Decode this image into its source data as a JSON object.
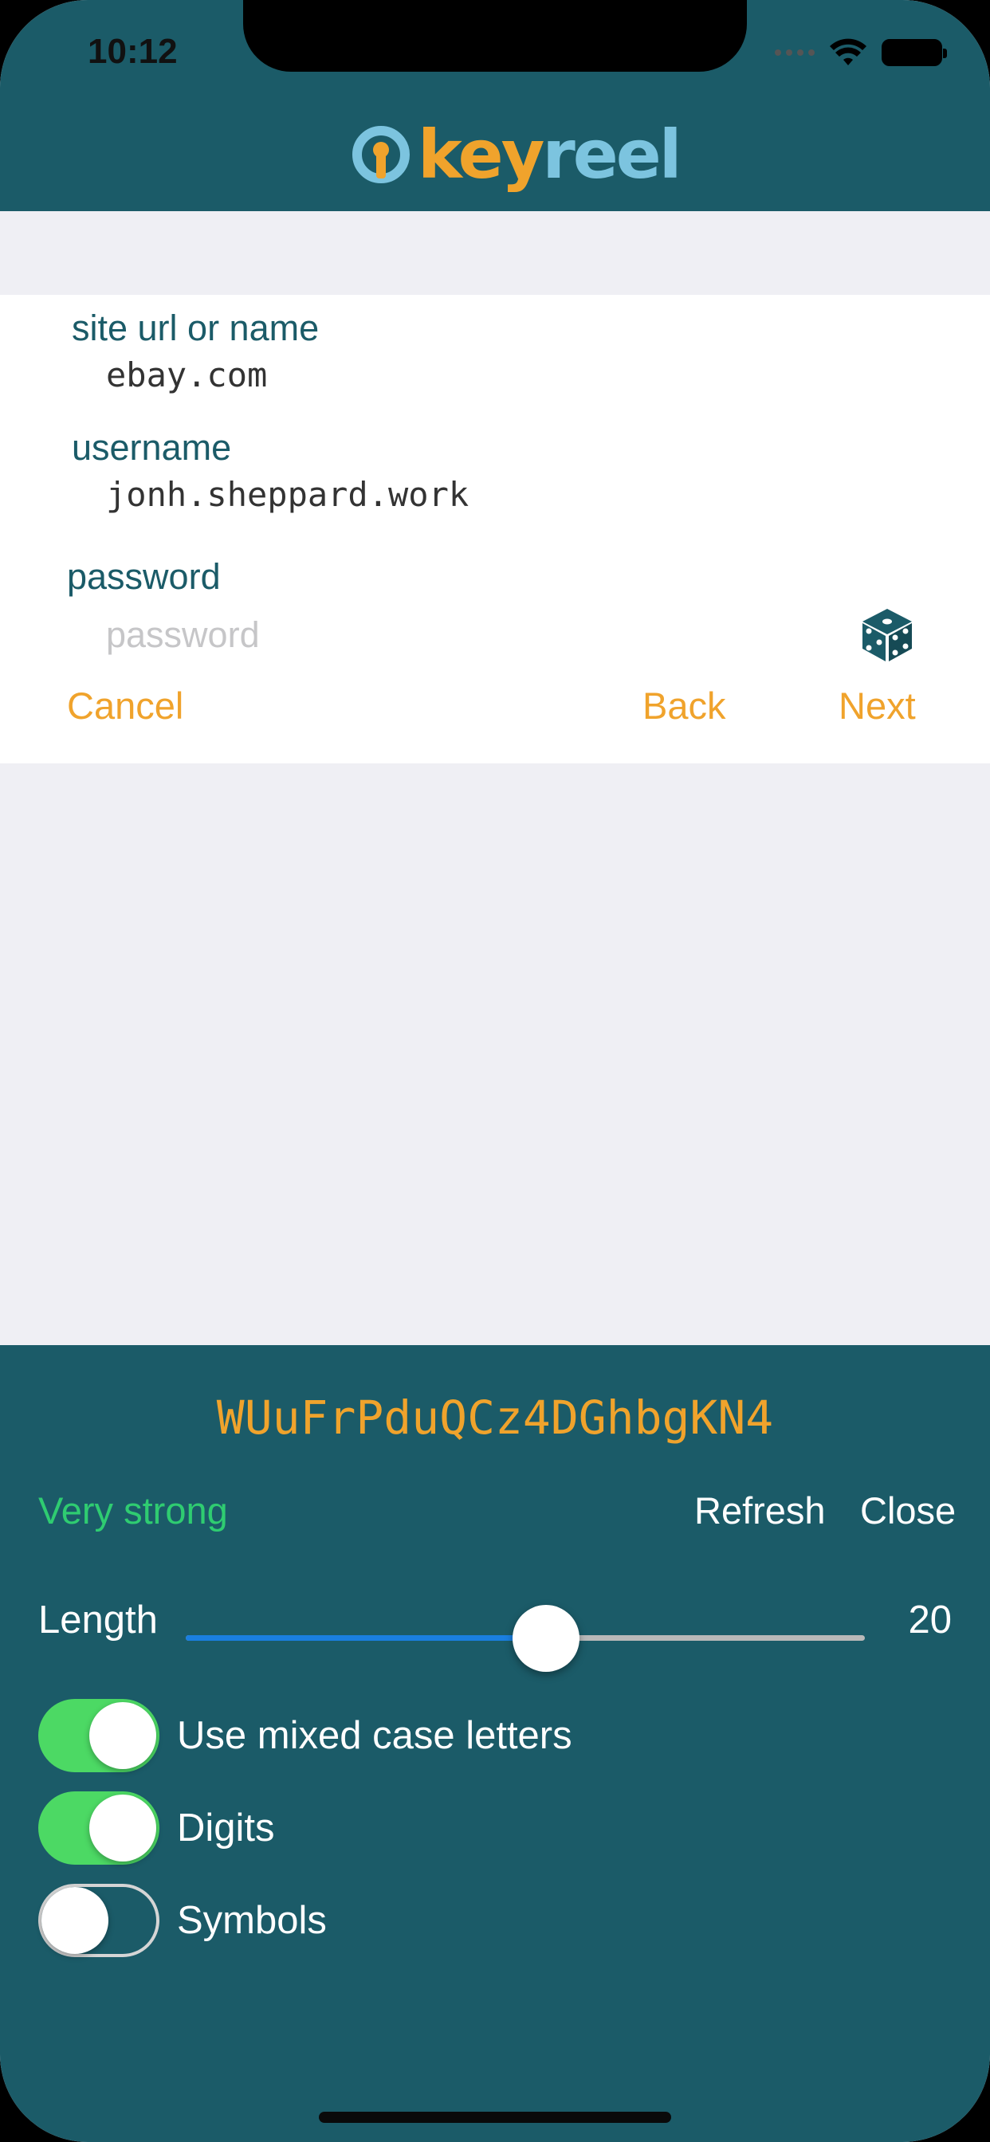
{
  "status_bar": {
    "time": "10:12"
  },
  "brand": {
    "key": "key",
    "reel": "reel"
  },
  "form": {
    "site": {
      "label": "site url or name",
      "value": "ebay.com"
    },
    "username": {
      "label": "username",
      "value": "jonh.sheppard.work"
    },
    "password": {
      "label": "password",
      "placeholder": "password"
    },
    "actions": {
      "cancel": "Cancel",
      "back": "Back",
      "next": "Next"
    }
  },
  "generator": {
    "password": "WUuFrPduQCz4DGhbgKN4",
    "strength": "Very strong",
    "refresh": "Refresh",
    "close": "Close",
    "length_label": "Length",
    "length_value": "20",
    "length_fraction": 0.53,
    "options": [
      {
        "label": "Use mixed case letters",
        "on": true
      },
      {
        "label": "Digits",
        "on": true
      },
      {
        "label": "Symbols",
        "on": false
      }
    ]
  },
  "colors": {
    "brand_teal": "#1b5b68",
    "accent_orange": "#f0a32c",
    "logo_blue": "#7cc4df",
    "strength_green": "#2fcc71",
    "toggle_green": "#4cd964",
    "slider_blue": "#1a7fe0"
  }
}
